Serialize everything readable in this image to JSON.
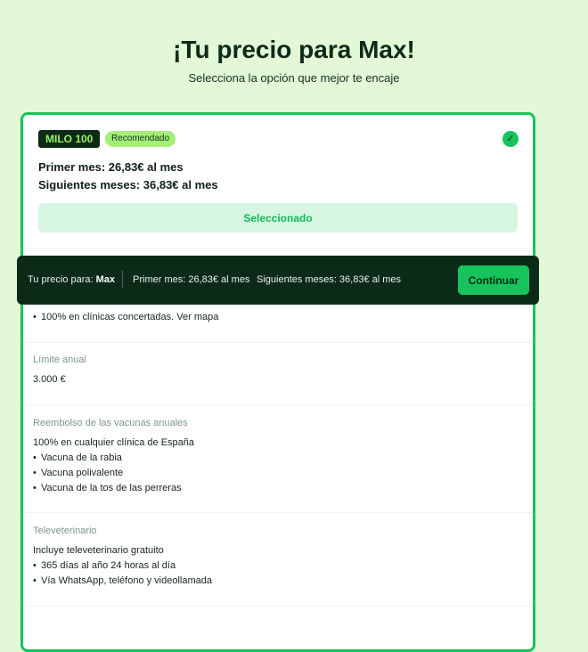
{
  "header": {
    "title": "¡Tu precio para Max!",
    "subtitle": "Selecciona la opción que mejor te encaje"
  },
  "plan": {
    "name": "MILO 100",
    "badge": "Recomendado",
    "first_month": "Primer mes: 26,83€ al mes",
    "following_months": "Siguientes meses: 36,83€ al mes",
    "selected_label": "Seleccionado",
    "check_icon": "check-icon"
  },
  "sections": {
    "clinics_bullet": "100% en clínicas concertadas. Ver mapa",
    "annual_limit": {
      "label": "Límite anual",
      "value": "3.000 €"
    },
    "vaccines": {
      "label": "Reembolso de las vacunas anuales",
      "intro": "100% en cualquier clínica de España",
      "items": [
        "Vacuna de la rabia",
        "Vacuna polivalente",
        "Vacuna de la tos de las perreras"
      ]
    },
    "televet": {
      "label": "Televeterinario",
      "intro": "Incluye televeterinario gratuito",
      "items": [
        "365 días al año 24 horas al día",
        "Vía WhatsApp, teléfono y videollamada"
      ]
    }
  },
  "sticky_bar": {
    "price_for_label": "Tu precio para:",
    "pet_name": "Max",
    "first_month": "Primer mes: 26,83€ al mes",
    "following_months": "Siguientes meses: 36,83€ al mes",
    "continue_label": "Continuar"
  },
  "colors": {
    "background": "#e3f8d6",
    "accent": "#17c45c",
    "dark": "#0b2a17",
    "badge_text": "#9ff06a"
  }
}
